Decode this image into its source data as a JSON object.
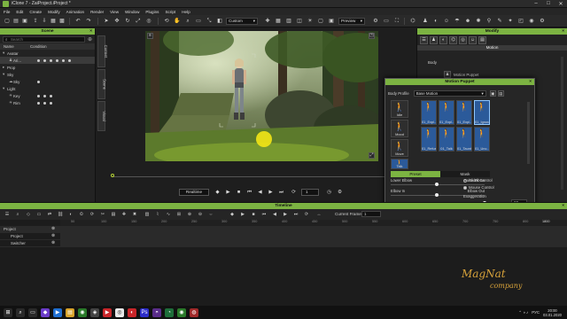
{
  "window": {
    "title": "iClone 7 - ZaiProject.iProject *"
  },
  "menu": [
    "File",
    "Edit",
    "Create",
    "Modify",
    "Animation",
    "Render",
    "View",
    "Window",
    "Plugins",
    "Script",
    "Help"
  ],
  "toolbar": {
    "camera_select": "Custom",
    "preview_select": "Preview"
  },
  "scene_panel": {
    "title": "Scene",
    "search_placeholder": "Search",
    "columns": [
      "Name",
      "Condition"
    ],
    "rows": [
      {
        "label": "Avatar",
        "indent": 0
      },
      {
        "label": "Ari...",
        "indent": 1
      },
      {
        "label": "Prop",
        "indent": 0
      },
      {
        "label": "Sky",
        "indent": 0
      },
      {
        "label": "Sky",
        "indent": 1
      },
      {
        "label": "Light",
        "indent": 0
      },
      {
        "label": "Key",
        "indent": 1
      },
      {
        "label": "Rim",
        "indent": 1
      }
    ]
  },
  "side_tabs": [
    "Content",
    "Scene",
    "Visual"
  ],
  "playback": {
    "mode": "Realtime",
    "frame": "1"
  },
  "modify_panel": {
    "title": "Modify",
    "section": "Motion",
    "body_label": "Body",
    "motion_puppet_button": "Motion Puppet"
  },
  "motion_puppet": {
    "title": "Motion Puppet",
    "body_profile_label": "Body Profile",
    "body_profile_value": "Base Motion",
    "profiles": [
      {
        "label": "Idle",
        "active": false
      },
      {
        "label": "Mood",
        "active": false
      },
      {
        "label": "Move",
        "active": false
      },
      {
        "label": "Talk",
        "active": true
      }
    ],
    "motions": [
      "01_Expl...",
      "01_Expl...",
      "01_Expl...",
      "01_Ignora...",
      "01_Refuse",
      "01_Talk",
      "01_Taunt",
      "01_Unc..."
    ],
    "tabs": {
      "preset": "Preset",
      "mask": "Mask"
    },
    "sliders": [
      {
        "left": "Lower Elbow",
        "right": "Raise Elbow"
      },
      {
        "left": "Elbow In",
        "right": "Elbow Out"
      },
      {
        "left": "Hands Back",
        "right": "Hands Forward"
      },
      {
        "left": "Narrow Stance",
        "right": "Wide Stance"
      },
      {
        "left": "Toes In",
        "right": "Toes Out"
      },
      {
        "left": "Stiff Neck",
        "right": "Loose Neck"
      }
    ],
    "control_modes": [
      {
        "label": "Slider Control",
        "selected": false
      },
      {
        "label": "Mouse Control",
        "selected": true
      }
    ],
    "exaggeration_label": "Exaggeration",
    "exaggeration_value": "60",
    "preview_label": "Preview",
    "record_label": "Record"
  },
  "timeline": {
    "title": "Timeline",
    "current_frame_label": "Current Frame :",
    "current_frame_value": "1",
    "end_frame": "1800",
    "ruler_ticks": [
      "50",
      "100",
      "150",
      "200",
      "250",
      "300",
      "350",
      "400",
      "450",
      "500",
      "550",
      "600",
      "650",
      "700",
      "750",
      "800"
    ],
    "tracks": [
      {
        "label": "Project",
        "indent": 0
      },
      {
        "label": "Project",
        "indent": 1
      },
      {
        "label": "Switcher",
        "indent": 1
      }
    ]
  },
  "watermark": {
    "line1": "MagNat",
    "line2": "company"
  },
  "taskbar": {
    "time": "20:00",
    "date": "03.01.2020",
    "lang": "РУС"
  },
  "colors": {
    "accent": "#7cb342",
    "highlight": "#b5d334",
    "record": "#d62a2a",
    "profile_active": "#2b5a9a"
  }
}
